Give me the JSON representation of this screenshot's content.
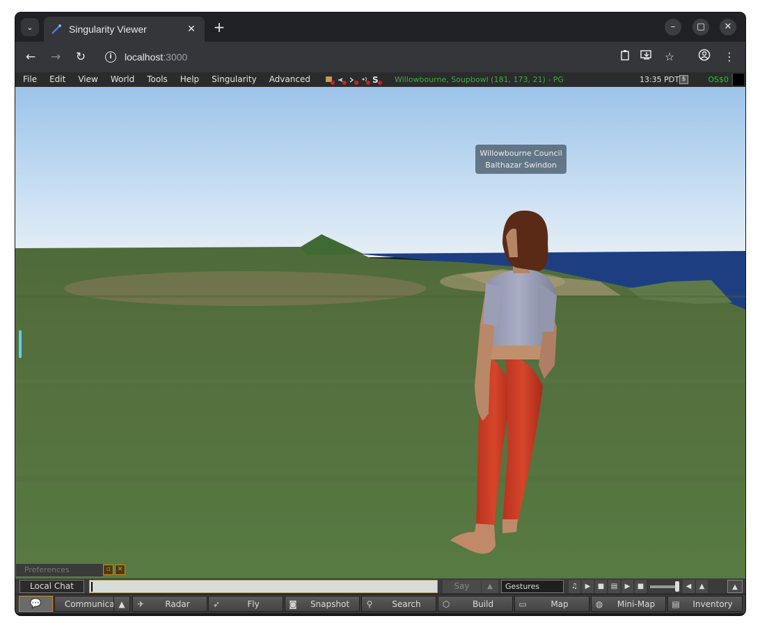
{
  "browser": {
    "tab_title": "Singularity Viewer",
    "url_host": "localhost",
    "url_port": ":3000",
    "icons": [
      "tab-search-icon",
      "close-icon",
      "plus-icon",
      "minimize-icon",
      "maximize-icon",
      "close-window-icon",
      "back-icon",
      "forward-icon",
      "reload-icon",
      "info-icon",
      "clipboard-icon",
      "install-icon",
      "star-icon",
      "profile-icon",
      "more-icon"
    ]
  },
  "viewer": {
    "menu": [
      "File",
      "Edit",
      "View",
      "World",
      "Tools",
      "Help",
      "Singularity",
      "Advanced"
    ],
    "location": "Willowbourne, Soupbowl (181, 173, 21) - PG",
    "clock": "13:35 PDT",
    "money_symbol": "$",
    "balance": "OS$0",
    "nametag": {
      "group": "Willowbourne Council",
      "name": "Balthazar Swindon"
    },
    "preferences_title": "Preferences",
    "chat": {
      "channel": "Local Chat",
      "say": "Say",
      "gestures": "Gestures"
    },
    "toolbar": {
      "communicate": "Communicat",
      "radar": "Radar",
      "fly": "Fly",
      "snapshot": "Snapshot",
      "search": "Search",
      "build": "Build",
      "map": "Map",
      "minimap": "Mini-Map",
      "inventory": "Inventory"
    }
  },
  "colors": {
    "location_text": "#3fae3a",
    "balance_text": "#18d818",
    "chat_border": "#c08a2a"
  }
}
